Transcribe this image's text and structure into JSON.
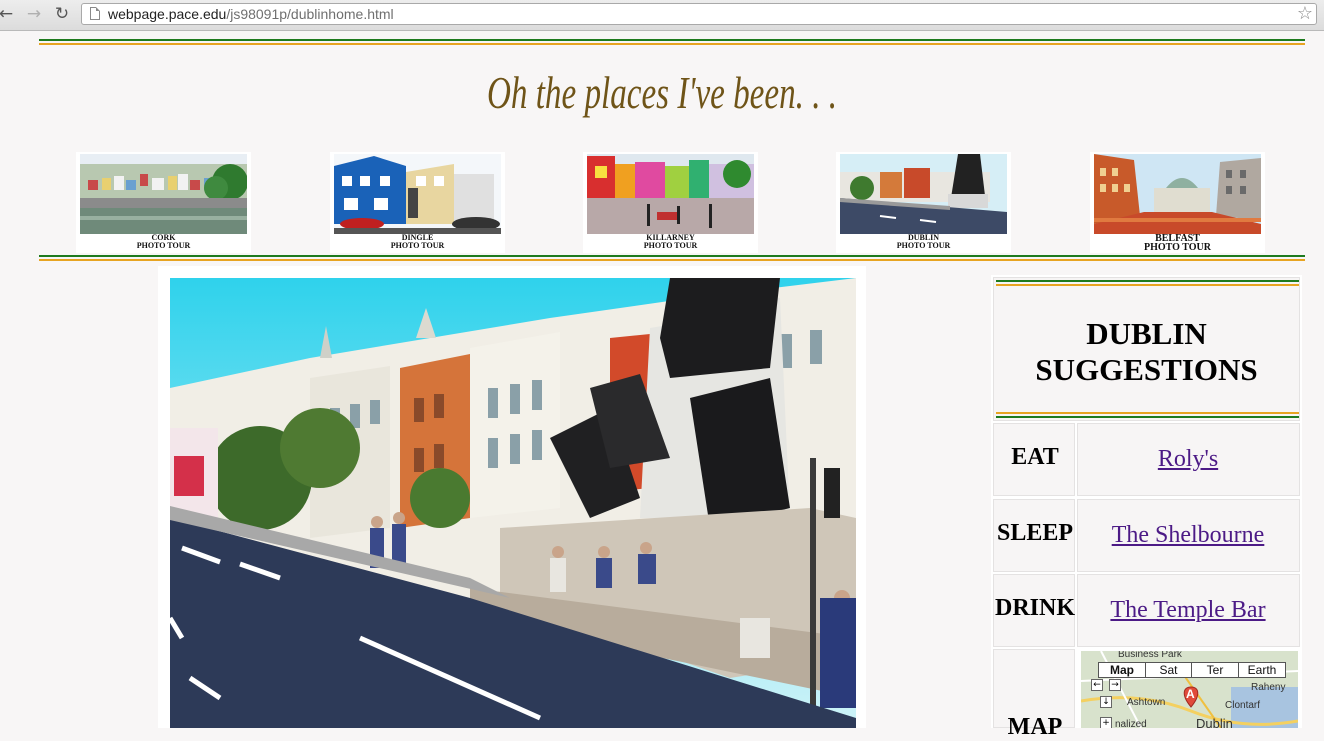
{
  "browser": {
    "url_host": "webpage.pace.edu",
    "url_path": "/js98091p/dublinhome.html",
    "back_icon": "back-arrow-icon",
    "forward_icon": "forward-arrow-icon",
    "reload_icon": "reload-icon",
    "star_icon": "bookmark-star-icon"
  },
  "banner": {
    "text": "Oh the places I've been. . ."
  },
  "tours": [
    {
      "line1": "CORK",
      "line2": "PHOTO TOUR"
    },
    {
      "line1": "DINGLE",
      "line2": "PHOTO TOUR"
    },
    {
      "line1": "KILLARNEY",
      "line2": "PHOTO TOUR"
    },
    {
      "line1": "DUBLIN",
      "line2": "PHOTO TOUR"
    },
    {
      "line1": "BELFAST",
      "line2": "PHOTO TOUR"
    }
  ],
  "sidebar": {
    "title_line1": "DUBLIN",
    "title_line2": "SUGGESTIONS",
    "rows": [
      {
        "label": "EAT",
        "link": "Roly's"
      },
      {
        "label": "SLEEP",
        "link": "The Shelbourne"
      },
      {
        "label": "DRINK",
        "link": "The Temple Bar"
      },
      {
        "label": "MAP"
      }
    ]
  },
  "map": {
    "buttons": [
      "Map",
      "Sat",
      "Ter",
      "Earth"
    ],
    "labels": [
      "Business Park",
      "Raheny",
      "Ashtown",
      "Clontarf",
      "Dublin",
      "nalized"
    ],
    "marker": "A"
  },
  "colors": {
    "green_rule": "#1e7a1e",
    "orange_rule": "#e7a421",
    "link": "#4c1a86",
    "banner": "#6f5418"
  }
}
